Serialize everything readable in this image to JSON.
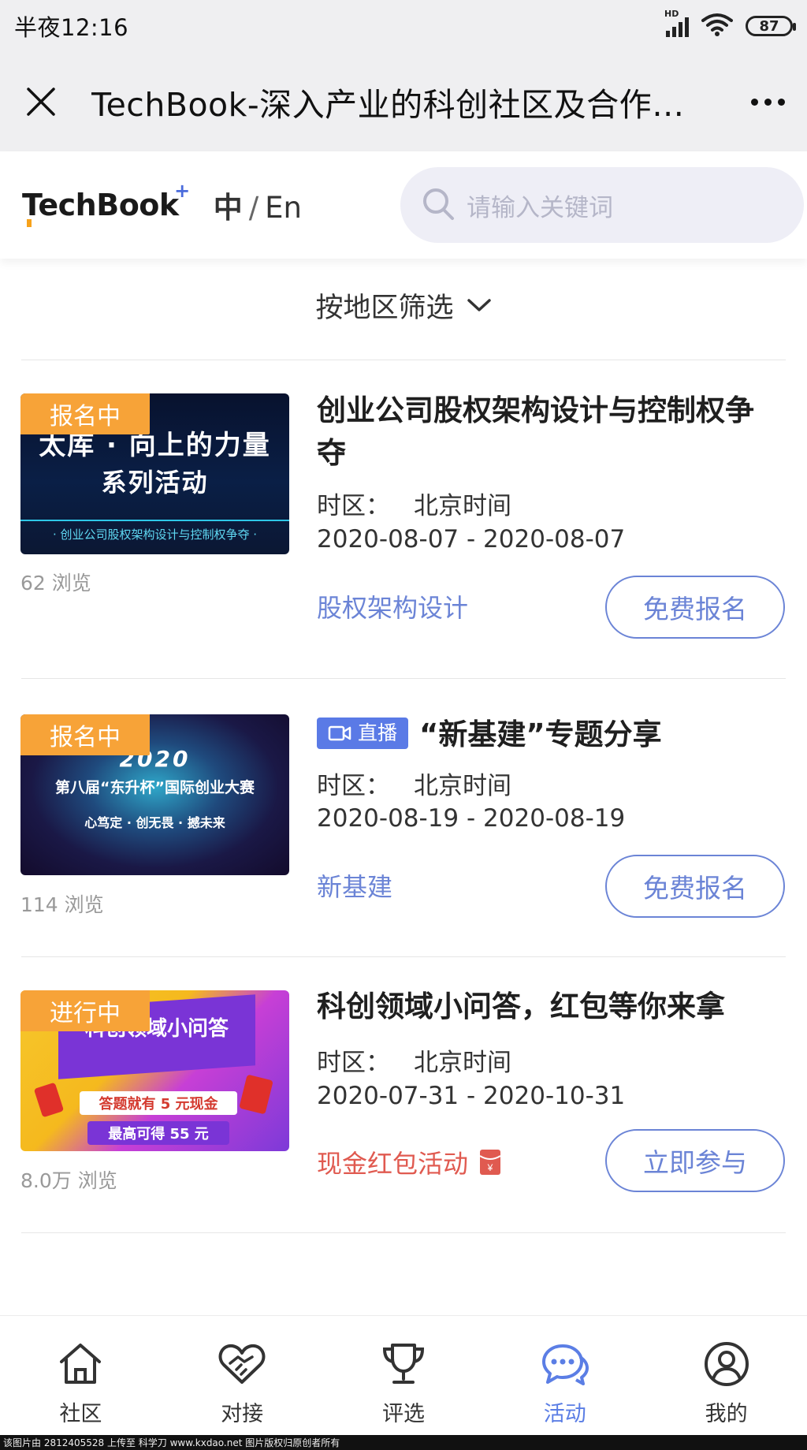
{
  "status_bar": {
    "time": "半夜12:16",
    "battery": "87",
    "network": "HD"
  },
  "title_bar": {
    "title": "TechBook-深入产业的科创社区及合作…"
  },
  "header": {
    "logo": "TechBook",
    "lang_zh": "中",
    "lang_sep": "/",
    "lang_en": "En",
    "search_placeholder": "请输入关键词"
  },
  "filter": {
    "label": "按地区筛选"
  },
  "events": [
    {
      "status": "报名中",
      "views": "62  浏览",
      "title": "创业公司股权架构设计与控制权争夺",
      "timezone_label": "时区：",
      "timezone": "北京时间",
      "date_range": "2020-08-07 - 2020-08-07",
      "tag": "股权架构设计",
      "action": "免费报名",
      "thumb_line1": "太库 · 向上的力量",
      "thumb_line2": "系列活动",
      "thumb_line3": "· 创业公司股权架构设计与控制权争夺 ·"
    },
    {
      "status": "报名中",
      "views": "114  浏览",
      "live": "直播",
      "title": "“新基建”专题分享",
      "timezone_label": "时区：",
      "timezone": "北京时间",
      "date_range": "2020-08-19 - 2020-08-19",
      "tag": "新基建",
      "action": "免费报名",
      "thumb_line1": "2020",
      "thumb_line2": "第八届“东升杯”国际创业大赛",
      "thumb_line3": "心笃定 · 创无畏 · 撼未来"
    },
    {
      "status": "进行中",
      "views": "8.0万  浏览",
      "title": "科创领域小问答，红包等你来拿",
      "timezone_label": "时区：",
      "timezone": "北京时间",
      "date_range": "2020-07-31 - 2020-10-31",
      "tag": "现金红包活动",
      "action": "立即参与",
      "thumb_line1": "科创领域小问答",
      "thumb_line2": "答题就有 5 元现金",
      "thumb_line3": "最高可得 55 元"
    }
  ],
  "bottom_nav": [
    {
      "label": "社区",
      "icon": "home-icon",
      "active": false
    },
    {
      "label": "对接",
      "icon": "handshake-icon",
      "active": false
    },
    {
      "label": "评选",
      "icon": "trophy-icon",
      "active": false
    },
    {
      "label": "活动",
      "icon": "chat-icon",
      "active": true
    },
    {
      "label": "我的",
      "icon": "user-icon",
      "active": false
    }
  ],
  "watermark": "该图片由 2812405528 上传至 科学刀 www.kxdao.net 图片版权归原创者所有",
  "colors": {
    "accent": "#6b84d6",
    "badge": "#f7a338",
    "red_tag": "#e05a50"
  }
}
